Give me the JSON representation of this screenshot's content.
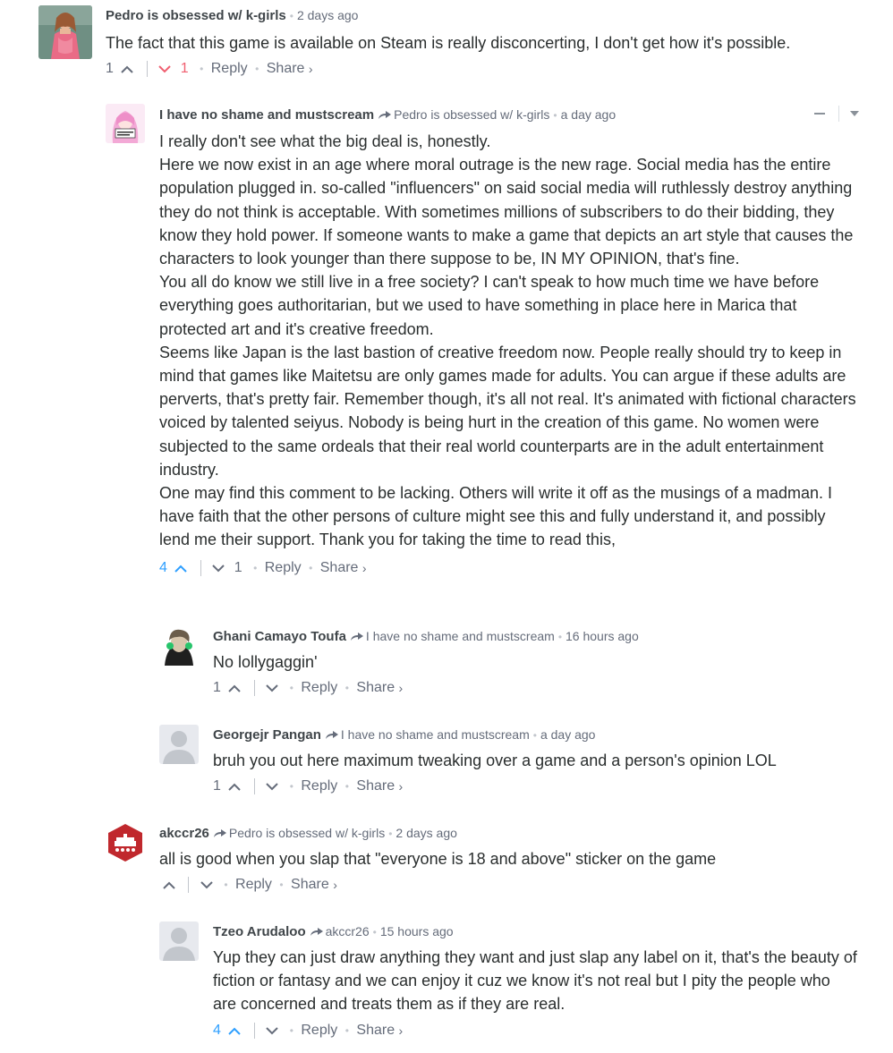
{
  "colors": {
    "upvote_active": "#2e9fff",
    "downvote_active": "#f05f70",
    "text": "#2a2e2e",
    "meta": "#656c7a"
  },
  "comments": [
    {
      "author": "Pedro is obsessed w/ k-girls",
      "parent": "",
      "time": "2 days ago",
      "paragraphs": [
        "The fact that this game is available on Steam is really disconcerting, I don't get how it's possible."
      ],
      "up_count": "1",
      "down_count": "1",
      "reply": "Reply",
      "share": "Share",
      "share_chevron": "›"
    },
    {
      "author": "I have no shame and mustscream",
      "parent": "Pedro is obsessed w/ k-girls",
      "time": "a day ago",
      "paragraphs": [
        "I really don't see what the big deal is, honestly.",
        "Here we now exist in an age where moral outrage is the new rage. Social media has the entire population plugged in. so-called \"influencers\" on said social media will ruthlessly destroy anything they do not think is acceptable. With sometimes millions of subscribers to do their bidding, they know they hold power. If someone wants to make a game that depicts an art style that causes the characters to look younger than there suppose to be, IN MY OPINION, that's fine.",
        "You all do know we still live in a free society? I can't speak to how much time we have before everything goes authoritarian, but we used to have something in place here in Marica that protected art and it's creative freedom.",
        "Seems like Japan is the last bastion of creative freedom now. People really should try to keep in mind that games like Maitetsu are only games made for adults. You can argue if these adults are perverts, that's pretty fair. Remember though, it's all not real. It's animated with fictional characters voiced by talented seiyus. Nobody is being hurt in the creation of this game. No women were subjected to the same ordeals that their real world counterparts are in the adult entertainment industry.",
        "One may find this comment to be lacking. Others will write it off as the musings of a madman. I have faith that the other persons of culture might see this and fully understand it, and possibly lend me their support. Thank you for taking the time to read this,"
      ],
      "up_count": "4",
      "down_count": "1",
      "reply": "Reply",
      "share": "Share",
      "share_chevron": "›"
    },
    {
      "author": "Ghani Camayo Toufa",
      "parent": "I have no shame and mustscream",
      "time": "16 hours ago",
      "paragraphs": [
        "No lollygaggin'"
      ],
      "up_count": "1",
      "down_count": "",
      "reply": "Reply",
      "share": "Share",
      "share_chevron": "›"
    },
    {
      "author": "Georgejr Pangan",
      "parent": "I have no shame and mustscream",
      "time": "a day ago",
      "paragraphs": [
        "bruh you out here maximum tweaking over a game and a person's opinion LOL"
      ],
      "up_count": "1",
      "down_count": "",
      "reply": "Reply",
      "share": "Share",
      "share_chevron": "›"
    },
    {
      "author": "akccr26",
      "parent": "Pedro is obsessed w/ k-girls",
      "time": "2 days ago",
      "paragraphs": [
        "all is good when you slap that \"everyone is 18 and above\" sticker on the game"
      ],
      "up_count": "",
      "down_count": "",
      "reply": "Reply",
      "share": "Share",
      "share_chevron": "›"
    },
    {
      "author": "Tzeo Arudaloo",
      "parent": "akccr26",
      "time": "15 hours ago",
      "paragraphs": [
        "Yup they can just draw anything they want and just slap any label on it, that's the beauty of fiction or fantasy and we can enjoy it cuz we know it's not real but I pity the people who are concerned and treats them as if they are real."
      ],
      "up_count": "4",
      "down_count": "",
      "reply": "Reply",
      "share": "Share",
      "share_chevron": "›"
    }
  ]
}
